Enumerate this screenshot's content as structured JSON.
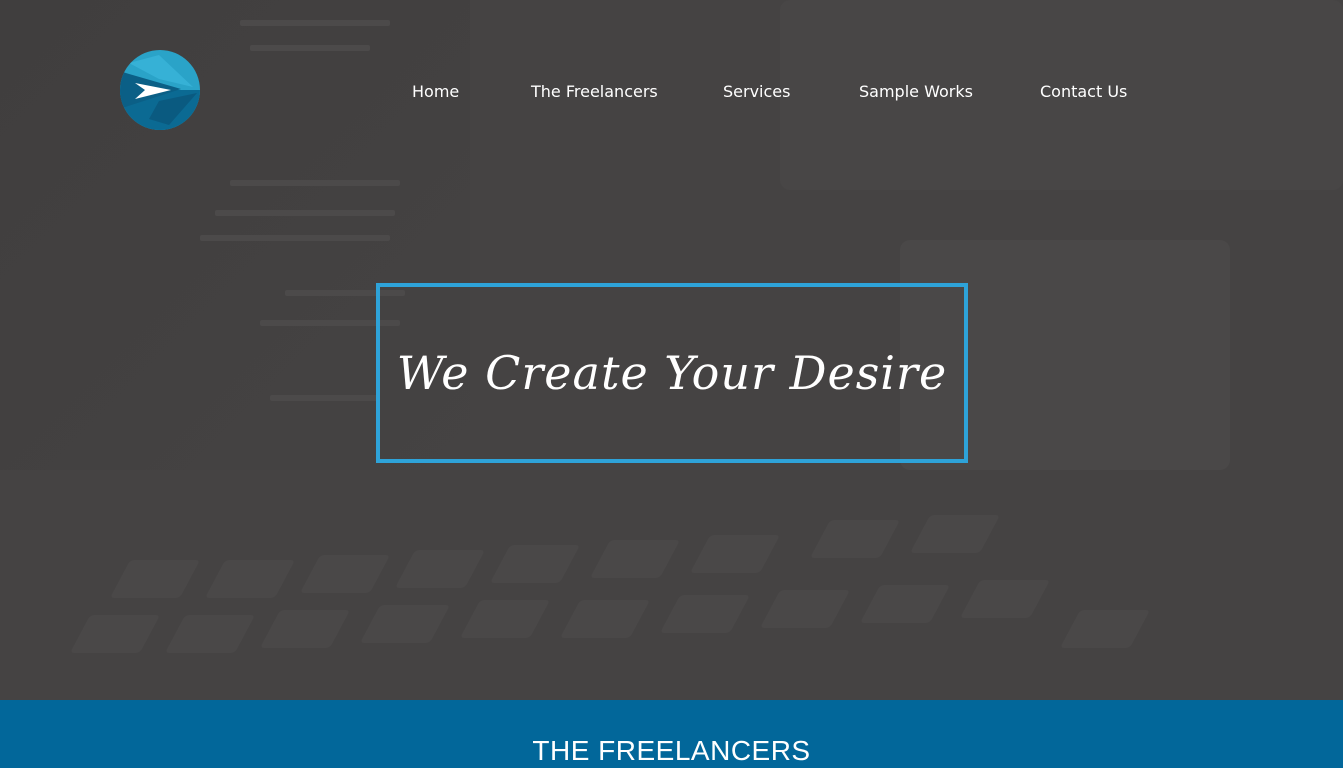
{
  "brand": {
    "logo_icon": "forward-arrow-circle-logo",
    "colors": {
      "logo_light": "#2aa3c8",
      "logo_dark": "#0b6a93",
      "accent_border": "#2ea3d9",
      "section_band": "#02679a",
      "hero_overlay": "#454343"
    }
  },
  "nav": {
    "items": [
      {
        "label": "Home"
      },
      {
        "label": "The Freelancers"
      },
      {
        "label": "Services"
      },
      {
        "label": "Sample Works"
      },
      {
        "label": "Contact Us"
      }
    ]
  },
  "hero": {
    "tagline": "We Create Your Desire"
  },
  "section": {
    "title": "THE FREELANCERS"
  }
}
